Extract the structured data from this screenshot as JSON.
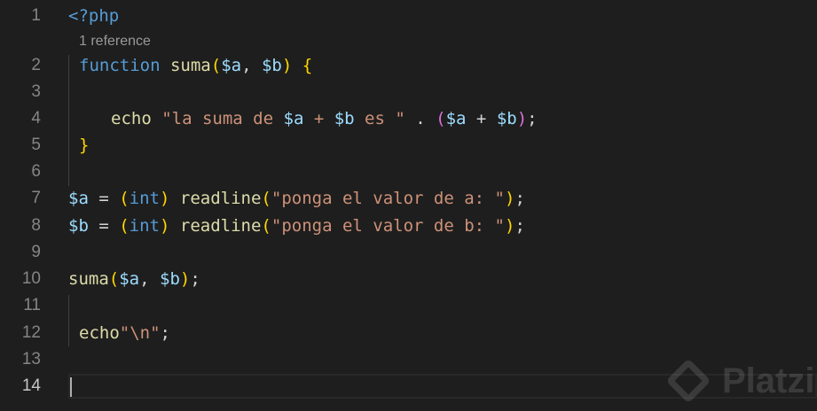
{
  "editor": {
    "codelens": "1 reference",
    "active_line": "14",
    "lines": [
      {
        "number": "1",
        "tokens": [
          {
            "t": "<?php",
            "k": "tag"
          }
        ]
      },
      {
        "number": "2",
        "tokens": [
          {
            "t": "function",
            "k": "keyword"
          },
          {
            "t": " ",
            "k": "plain"
          },
          {
            "t": "suma",
            "k": "function"
          },
          {
            "t": "(",
            "k": "bracket1"
          },
          {
            "t": "$a",
            "k": "variable"
          },
          {
            "t": ", ",
            "k": "plain"
          },
          {
            "t": "$b",
            "k": "variable"
          },
          {
            "t": ")",
            "k": "bracket1"
          },
          {
            "t": " ",
            "k": "plain"
          },
          {
            "t": "{",
            "k": "bracket1"
          }
        ]
      },
      {
        "number": "3",
        "tokens": []
      },
      {
        "number": "4",
        "tokens": [
          {
            "t": "echo",
            "k": "function"
          },
          {
            "t": " ",
            "k": "plain"
          },
          {
            "t": "\"la suma de ",
            "k": "string"
          },
          {
            "t": "$a",
            "k": "variable"
          },
          {
            "t": " + ",
            "k": "string"
          },
          {
            "t": "$b",
            "k": "variable"
          },
          {
            "t": " es \"",
            "k": "string"
          },
          {
            "t": " . ",
            "k": "plain"
          },
          {
            "t": "(",
            "k": "bracket2"
          },
          {
            "t": "$a",
            "k": "variable"
          },
          {
            "t": " + ",
            "k": "plain"
          },
          {
            "t": "$b",
            "k": "variable"
          },
          {
            "t": ")",
            "k": "bracket2"
          },
          {
            "t": ";",
            "k": "plain"
          }
        ]
      },
      {
        "number": "5",
        "tokens": [
          {
            "t": "}",
            "k": "bracket1"
          }
        ]
      },
      {
        "number": "6",
        "tokens": []
      },
      {
        "number": "7",
        "tokens": [
          {
            "t": "$a",
            "k": "variable"
          },
          {
            "t": " = ",
            "k": "plain"
          },
          {
            "t": "(",
            "k": "bracket1"
          },
          {
            "t": "int",
            "k": "type"
          },
          {
            "t": ")",
            "k": "bracket1"
          },
          {
            "t": " ",
            "k": "plain"
          },
          {
            "t": "readline",
            "k": "function"
          },
          {
            "t": "(",
            "k": "bracket1"
          },
          {
            "t": "\"ponga el valor de a: \"",
            "k": "string"
          },
          {
            "t": ")",
            "k": "bracket1"
          },
          {
            "t": ";",
            "k": "plain"
          }
        ]
      },
      {
        "number": "8",
        "tokens": [
          {
            "t": "$b",
            "k": "variable"
          },
          {
            "t": " = ",
            "k": "plain"
          },
          {
            "t": "(",
            "k": "bracket1"
          },
          {
            "t": "int",
            "k": "type"
          },
          {
            "t": ")",
            "k": "bracket1"
          },
          {
            "t": " ",
            "k": "plain"
          },
          {
            "t": "readline",
            "k": "function"
          },
          {
            "t": "(",
            "k": "bracket1"
          },
          {
            "t": "\"ponga el valor de b: \"",
            "k": "string"
          },
          {
            "t": ")",
            "k": "bracket1"
          },
          {
            "t": ";",
            "k": "plain"
          }
        ]
      },
      {
        "number": "9",
        "tokens": []
      },
      {
        "number": "10",
        "tokens": [
          {
            "t": "suma",
            "k": "function"
          },
          {
            "t": "(",
            "k": "bracket1"
          },
          {
            "t": "$a",
            "k": "variable"
          },
          {
            "t": ", ",
            "k": "plain"
          },
          {
            "t": "$b",
            "k": "variable"
          },
          {
            "t": ")",
            "k": "bracket1"
          },
          {
            "t": ";",
            "k": "plain"
          }
        ]
      },
      {
        "number": "11",
        "tokens": []
      },
      {
        "number": "12",
        "tokens": [
          {
            "t": "echo",
            "k": "function"
          },
          {
            "t": "\"\\n\"",
            "k": "string"
          },
          {
            "t": ";",
            "k": "plain"
          }
        ]
      },
      {
        "number": "13",
        "tokens": []
      },
      {
        "number": "14",
        "tokens": []
      }
    ]
  },
  "watermark": {
    "text": "Platzi",
    "icon": "platzi-logo-icon"
  }
}
